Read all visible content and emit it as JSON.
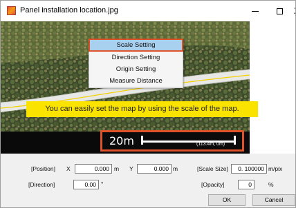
{
  "window": {
    "title": "Panel installation location.jpg",
    "minimize_glyph": "—",
    "close_glyph": "X"
  },
  "context_menu": {
    "items": [
      {
        "label": "Scale Setting",
        "selected": true
      },
      {
        "label": "Direction Setting",
        "selected": false
      },
      {
        "label": "Origin Setting",
        "selected": false
      },
      {
        "label": "Measure Distance",
        "selected": false
      }
    ],
    "highlight_color": "#e0522a"
  },
  "callout": {
    "text": "You can easily set the map by using the scale of the map.",
    "color": "#fbe300"
  },
  "scale_overlay": {
    "label": "20m",
    "coord": "(113.4m, 0m)"
  },
  "form": {
    "position_label": "[Position]",
    "x_label": "X",
    "x_value": "0.000",
    "x_unit": "m",
    "y_label": "Y",
    "y_value": "0.000",
    "y_unit": "m",
    "scale_size_label": "[Scale Size]",
    "scale_size_value": "0. 100000",
    "scale_size_unit": "m/pix",
    "direction_label": "[Direction]",
    "direction_value": "0.00",
    "direction_unit": "°",
    "opacity_label": "[Opacity]",
    "opacity_value": "0",
    "opacity_unit": "%",
    "ok_label": "OK",
    "cancel_label": "Cancel"
  }
}
